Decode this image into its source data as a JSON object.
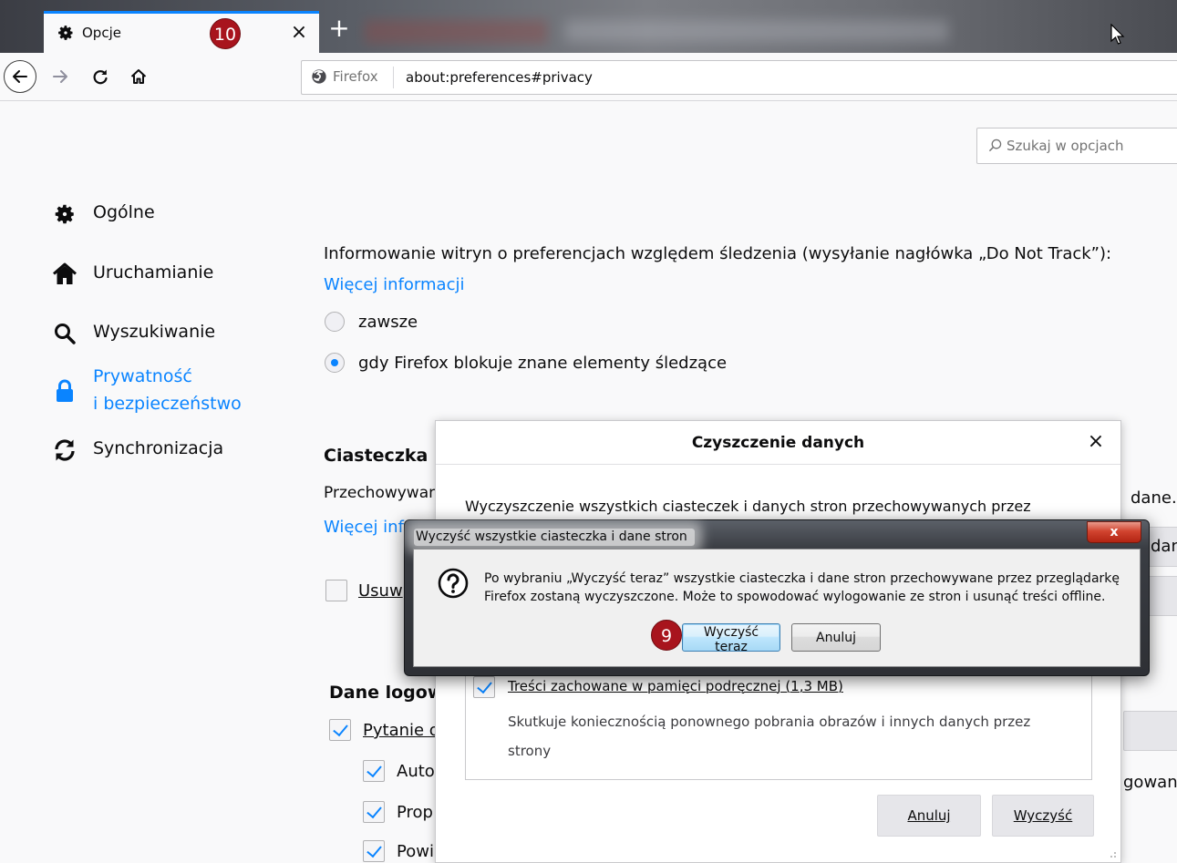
{
  "tab": {
    "title": "Opcje",
    "close_glyph": "×",
    "new_tab_glyph": "+"
  },
  "urlbar": {
    "identity_label": "Firefox",
    "url": "about:preferences#privacy"
  },
  "search": {
    "placeholder": "Szukaj w opcjach"
  },
  "sidebar": {
    "items": [
      {
        "label": "Ogólne",
        "icon": "gear-icon"
      },
      {
        "label": "Uruchamianie",
        "icon": "home-icon"
      },
      {
        "label": "Wyszukiwanie",
        "icon": "search-icon"
      },
      {
        "label_line1": "Prywatność",
        "label_line2": "i bezpieczeństwo",
        "icon": "lock-icon",
        "selected": true
      },
      {
        "label": "Synchronizacja",
        "icon": "sync-icon"
      }
    ]
  },
  "privacy": {
    "dnt_text": "Informowanie witryn o preferencjach względem śledzenia (wysyłanie nagłówka „Do Not Track”):",
    "more_info": "Więcej informacji",
    "option_always": "zawsze",
    "option_when_blocking": "gdy Firefox blokuje znane elementy śledzące",
    "cookies_heading": "Ciasteczka i",
    "cookies_text": "Przechowywan",
    "cookies_more_info": "Więcej inf",
    "delete_label": "Usuw",
    "right_fragment_1": "dane.",
    "right_fragment_2": "dane",
    "logins_heading": "Dane logow",
    "ask_label": "Pytanie o",
    "auto_label": "Auto",
    "prop_label": "Prop",
    "pow_label": "Powi",
    "right_fragment_3": "gowani"
  },
  "clear_dialog": {
    "title": "Czyszczenie danych",
    "close_glyph": "×",
    "description": "Wyczyszczenie wszystkich ciasteczek i danych stron przechowywanych przez",
    "cache_option": "Treści zachowane w pamięci podręcznej (1,3 MB)",
    "cache_description": "Skutkuje koniecznością ponownego pobrania obrazów i innych danych przez strony",
    "cancel_label": "Anuluj",
    "clear_label": "Wyczyść"
  },
  "confirm_dialog": {
    "title": "Wyczyść wszystkie ciasteczka i dane stron",
    "close_glyph": "x",
    "message_line1": "Po wybraniu „Wyczyść teraz” wszystkie ciasteczka i dane stron przechowywane przez przeglądarkę",
    "message_line2": "Firefox zostaną wyczyszczone. Może to spowodować wylogowanie ze stron i usunąć treści offline.",
    "clear_now_label": "Wyczyść teraz",
    "cancel_label": "Anuluj"
  },
  "badges": {
    "step_9": "9",
    "step_10": "10"
  },
  "colors": {
    "accent": "#0a84ff",
    "badge": "#a8141d"
  }
}
